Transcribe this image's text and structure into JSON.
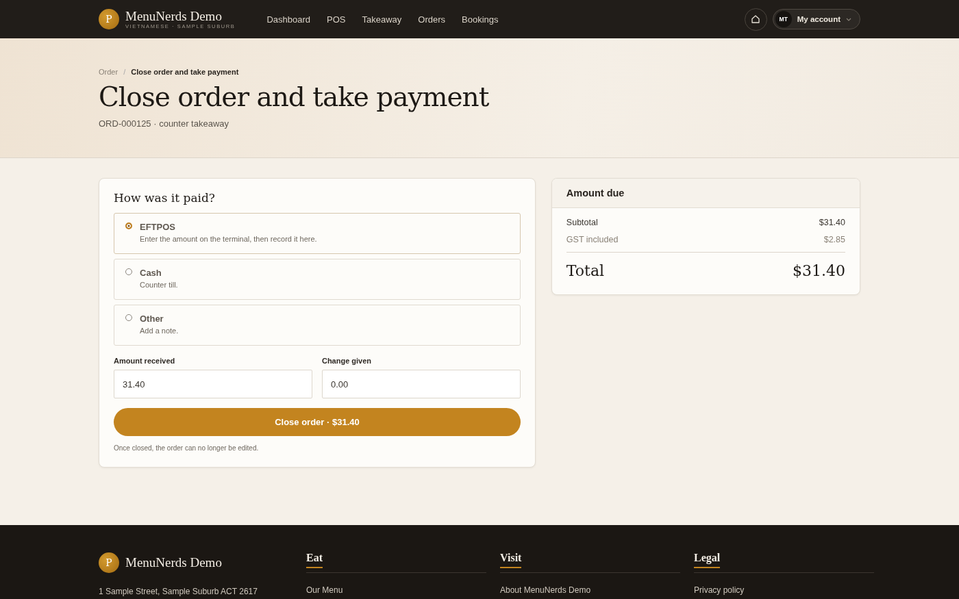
{
  "header": {
    "logo_letter": "P",
    "brand": "MenuNerds Demo",
    "tagline": "VIETNAMESE · SAMPLE SUBURB",
    "nav": [
      {
        "label": "Dashboard"
      },
      {
        "label": "POS"
      },
      {
        "label": "Takeaway"
      },
      {
        "label": "Orders"
      },
      {
        "label": "Bookings"
      }
    ],
    "avatar_initials": "MT",
    "account_label": "My account"
  },
  "breadcrumb": [
    {
      "label": "Order",
      "current": false
    },
    {
      "label": "Close order and take payment",
      "current": true
    }
  ],
  "breadcrumb_separator": "/",
  "title": "Close order and take payment",
  "subtitle": "ORD-000125 · counter takeaway",
  "payment": {
    "heading": "How was it paid?",
    "methods": [
      {
        "label": "EFTPOS",
        "description": "Enter the amount on the terminal, then record it here.",
        "selected": true
      },
      {
        "label": "Cash",
        "description": "Counter till.",
        "selected": false
      },
      {
        "label": "Other",
        "description": "Add a note.",
        "selected": false
      }
    ],
    "fields": [
      {
        "label": "Amount received",
        "value": "31.40"
      },
      {
        "label": "Change given",
        "value": "0.00"
      }
    ],
    "submit": "Close order · $31.40",
    "note": "Once closed, the order can no longer be edited."
  },
  "summary": {
    "heading": "Amount due",
    "lines": [
      {
        "label": "Subtotal",
        "value": "$31.40",
        "muted": false
      },
      {
        "label": "GST included",
        "value": "$2.85",
        "muted": true
      }
    ],
    "total_label": "Total",
    "total_value": "$31.40"
  },
  "footer": {
    "logo_letter": "P",
    "brand": "MenuNerds Demo",
    "address": "1 Sample Street, Sample Suburb ACT 2617",
    "columns": [
      {
        "heading": "Eat",
        "links": [
          "Our Menu"
        ]
      },
      {
        "heading": "Visit",
        "links": [
          "About MenuNerds Demo"
        ]
      },
      {
        "heading": "Legal",
        "links": [
          "Privacy policy"
        ]
      }
    ]
  }
}
